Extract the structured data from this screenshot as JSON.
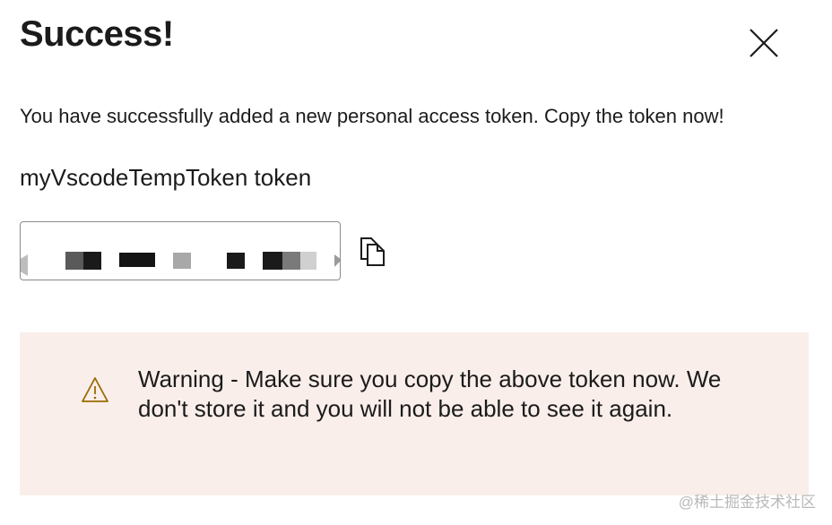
{
  "dialog": {
    "title": "Success!",
    "message": "You have successfully added a new personal access token. Copy the token now!",
    "token_name": "myVscodeTempToken token"
  },
  "icons": {
    "close": "close-icon",
    "copy": "copy-icon",
    "warning": "warning-icon"
  },
  "warning": {
    "text": "Warning - Make sure you copy the above token now. We don't store it and you will not be able to see it again."
  },
  "watermark": "@稀土掘金技术社区",
  "colors": {
    "warning_background": "#f9eeea",
    "warning_icon": "#9a6b00",
    "text": "#1b1b1b"
  }
}
